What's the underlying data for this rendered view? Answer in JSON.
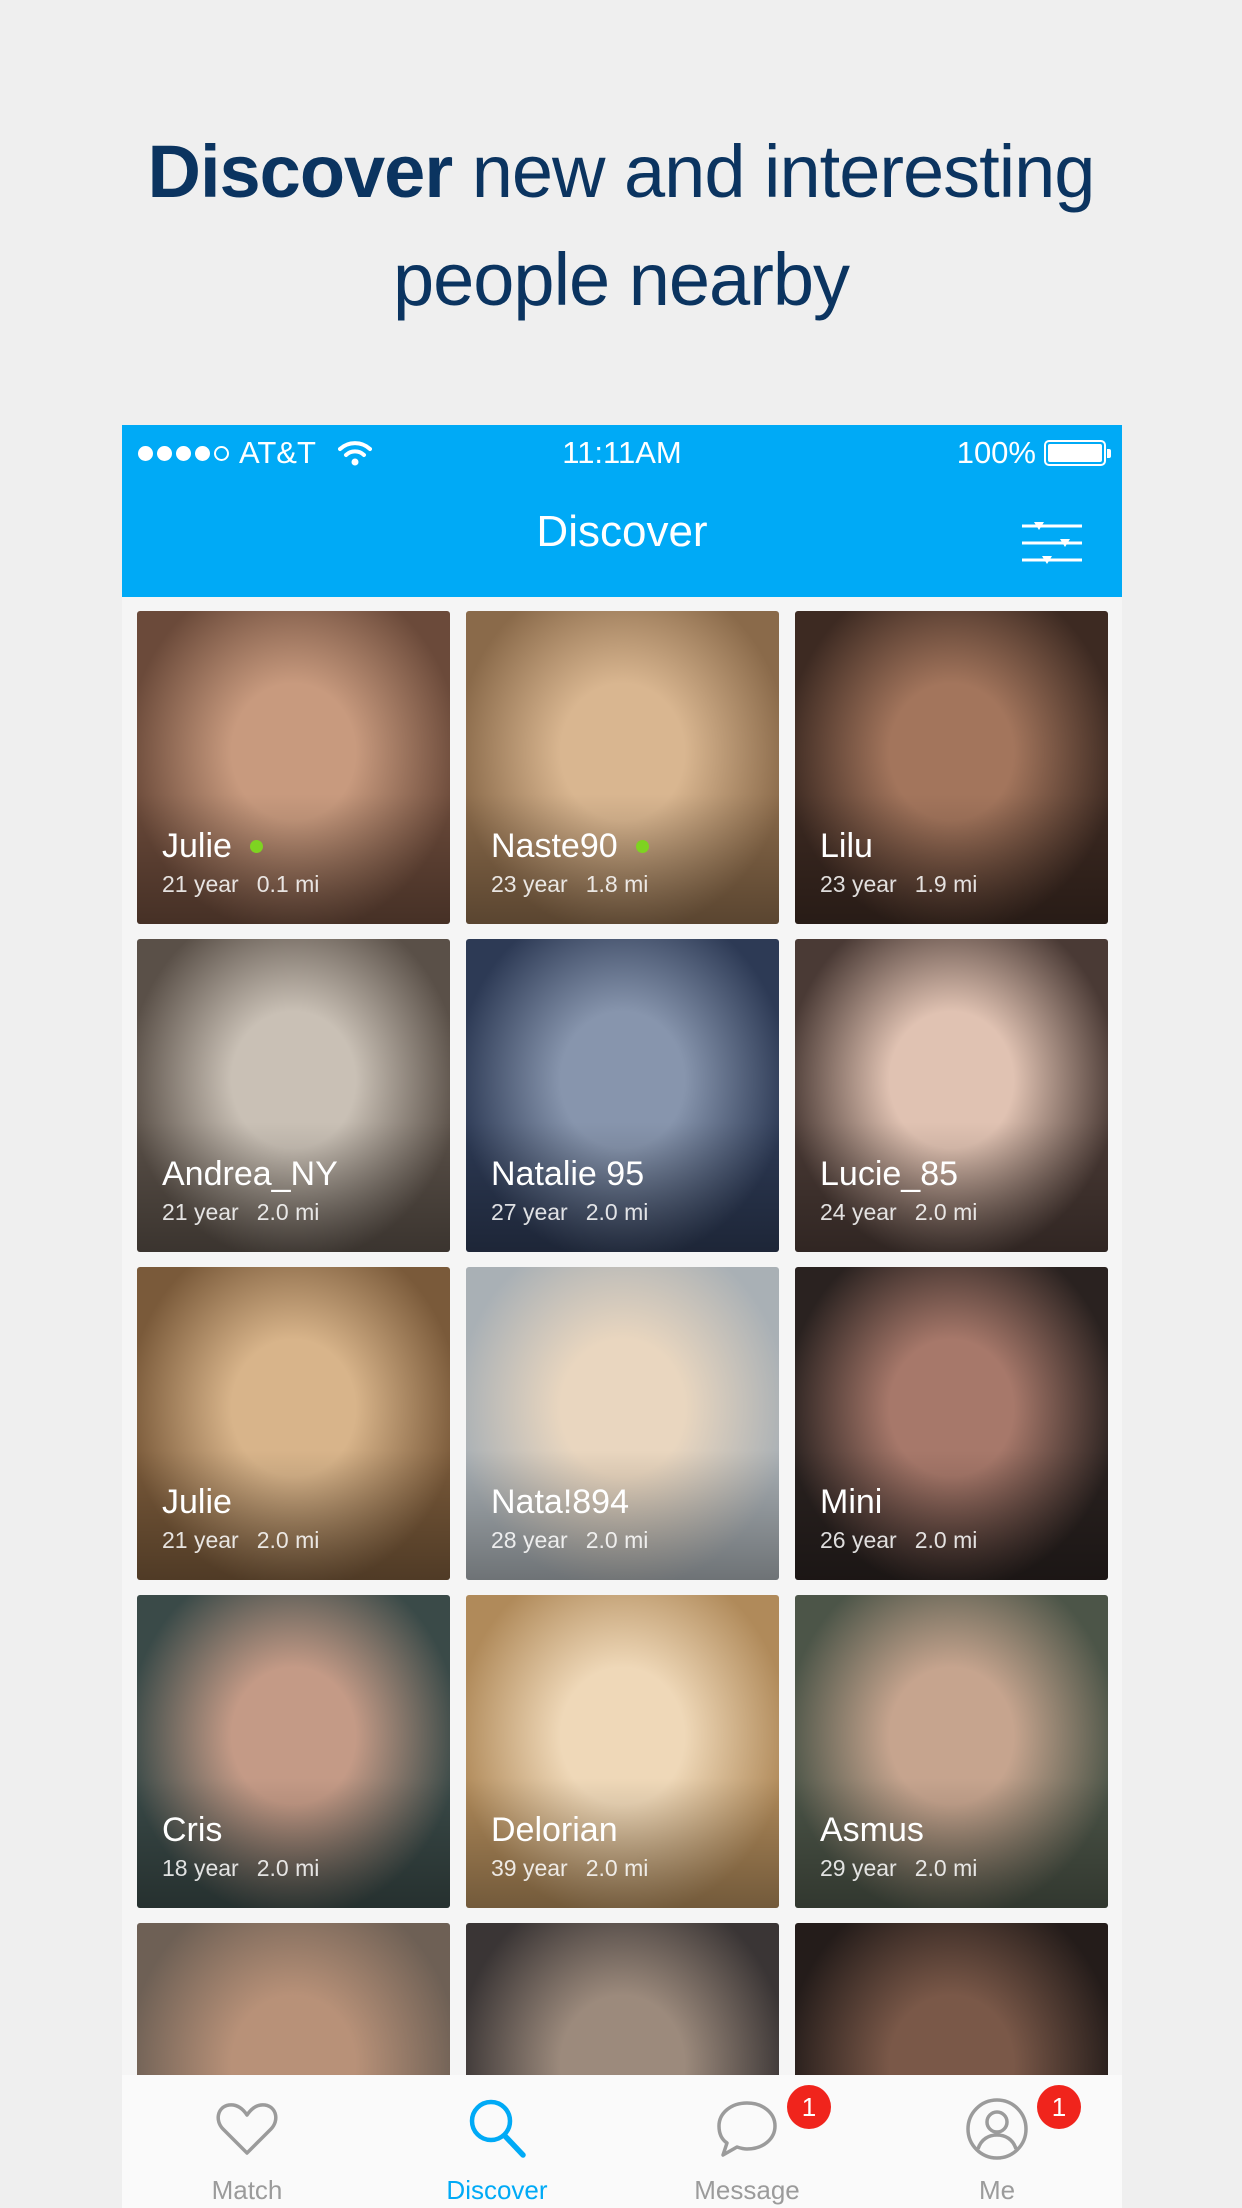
{
  "headline": {
    "strong": "Discover",
    "rest_line1": "new and interesting",
    "line2": "people nearby"
  },
  "status_bar": {
    "carrier": "AT&T",
    "time": "11:11AM",
    "battery": "100%"
  },
  "nav": {
    "title": "Discover",
    "filter_icon": "sliders-icon"
  },
  "colors": {
    "accent": "#00aaf6",
    "headline": "#0b3460",
    "online": "#7ed321",
    "badge": "#f0241c"
  },
  "profiles": [
    {
      "name": "Julie",
      "age": "21 year",
      "distance": "0.1 mi",
      "online": true
    },
    {
      "name": "Naste90",
      "age": "23 year",
      "distance": "1.8 mi",
      "online": true
    },
    {
      "name": "Lilu",
      "age": "23 year",
      "distance": "1.9 mi",
      "online": false
    },
    {
      "name": "Andrea_NY",
      "age": "21 year",
      "distance": "2.0 mi",
      "online": false
    },
    {
      "name": "Natalie 95",
      "age": "27 year",
      "distance": "2.0 mi",
      "online": false
    },
    {
      "name": "Lucie_85",
      "age": "24 year",
      "distance": "2.0 mi",
      "online": false
    },
    {
      "name": "Julie",
      "age": "21 year",
      "distance": "2.0 mi",
      "online": false
    },
    {
      "name": "Nata!894",
      "age": "28 year",
      "distance": "2.0 mi",
      "online": false
    },
    {
      "name": "Mini",
      "age": "26 year",
      "distance": "2.0 mi",
      "online": false
    },
    {
      "name": "Cris",
      "age": "18 year",
      "distance": "2.0 mi",
      "online": false
    },
    {
      "name": "Delorian",
      "age": "39 year",
      "distance": "2.0 mi",
      "online": false
    },
    {
      "name": "Asmus",
      "age": "29 year",
      "distance": "2.0 mi",
      "online": false
    },
    {
      "name": "",
      "age": "",
      "distance": "",
      "online": false
    },
    {
      "name": "",
      "age": "",
      "distance": "",
      "online": false
    },
    {
      "name": "",
      "age": "",
      "distance": "",
      "online": false
    }
  ],
  "tabs": [
    {
      "label": "Match",
      "icon": "heart-icon",
      "badge": ""
    },
    {
      "label": "Discover",
      "icon": "search-icon",
      "badge": ""
    },
    {
      "label": "Message",
      "icon": "chat-bubble-icon",
      "badge": "1"
    },
    {
      "label": "Me",
      "icon": "profile-icon",
      "badge": "1"
    }
  ]
}
